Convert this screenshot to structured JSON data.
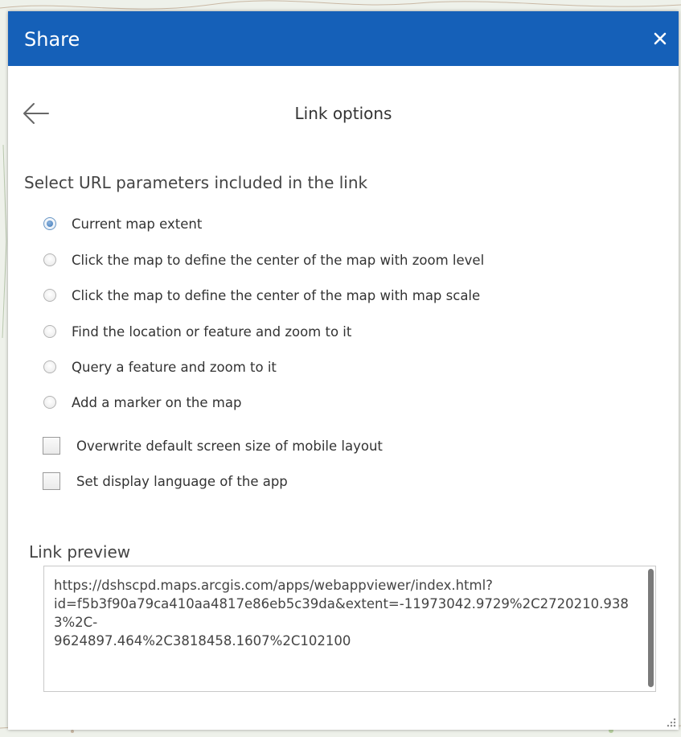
{
  "dialog": {
    "title": "Share",
    "close_icon": "close-icon",
    "back_icon": "arrow-left-icon",
    "subtitle": "Link options"
  },
  "url_params": {
    "heading": "Select URL parameters included in the link",
    "options": [
      {
        "label": "Current map extent",
        "checked": true
      },
      {
        "label": "Click the map to define the center of the map with zoom level",
        "checked": false
      },
      {
        "label": "Click the map to define the center of the map with map scale",
        "checked": false
      },
      {
        "label": "Find the location or feature and zoom to it",
        "checked": false
      },
      {
        "label": "Query a feature and zoom to it",
        "checked": false
      },
      {
        "label": "Add a marker on the map",
        "checked": false
      }
    ],
    "checkboxes": [
      {
        "label": "Overwrite default screen size of mobile layout",
        "checked": false
      },
      {
        "label": "Set display language of the app",
        "checked": false
      }
    ]
  },
  "link_preview": {
    "heading": "Link preview",
    "text": "https://dshscpd.maps.arcgis.com/apps/webappviewer/index.html?\nid=f5b3f90a79ca410aa4817e86eb5c39da&extent=-11973042.9729%2C2720210.9383%2C-\n9624897.464%2C3818458.1607%2C102100"
  },
  "colors": {
    "titlebar": "#1560b8",
    "title_text": "#ffffff",
    "radio_selected": "#3a75b5"
  }
}
